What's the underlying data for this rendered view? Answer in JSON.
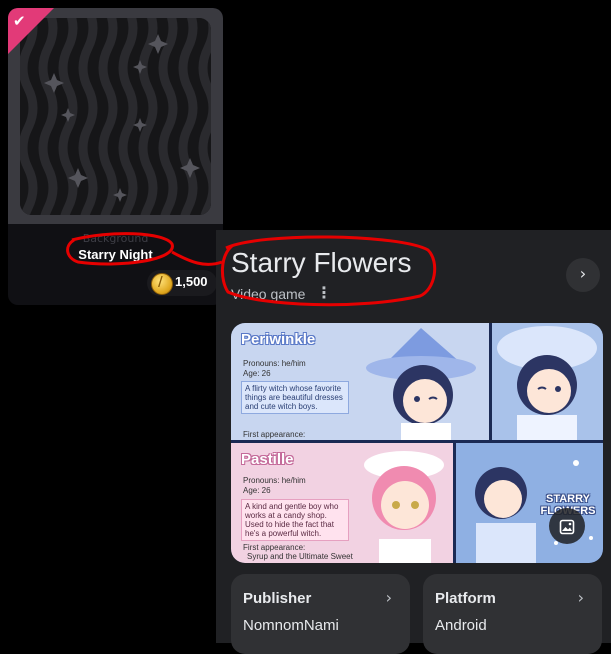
{
  "store_card": {
    "category": "Background",
    "title": "Starry Night",
    "price": "1,500",
    "owned_check": "✔"
  },
  "knowledge_panel": {
    "title": "Starry Flowers",
    "subtitle": "Video game",
    "more_icon": "⋮",
    "next_icon": "›",
    "gallery": {
      "tile1": {
        "name": "Periwinkle",
        "pronouns": "Pronouns: he/him",
        "age": "Age: 26",
        "description": "A flirty witch whose favorite things are beautiful dresses and cute witch boys.",
        "first_appearance": "First appearance:"
      },
      "tile3": {
        "name": "Pastille",
        "pronouns": "Pronouns: he/him",
        "age": "Age: 26",
        "description": "A kind and gentle boy who works at a candy shop. Used to hide the fact that he's a powerful witch.",
        "first_appearance": "First appearance:",
        "first_appearance_value": "Syrup and the Ultimate Sweet"
      },
      "tile4_logo": "STARRY FLOWERS"
    },
    "info_cards": [
      {
        "label": "Publisher",
        "value": "NomnomNami"
      },
      {
        "label": "Platform",
        "value": "Android"
      }
    ]
  },
  "colors": {
    "badge": "#e23a78",
    "annotation": "#e60000",
    "panel_bg": "#202124",
    "card_bg": "#303134"
  },
  "icons": [
    "check-icon",
    "coin-icon",
    "more-vert-icon",
    "chevron-right-icon",
    "image-search-icon"
  ]
}
